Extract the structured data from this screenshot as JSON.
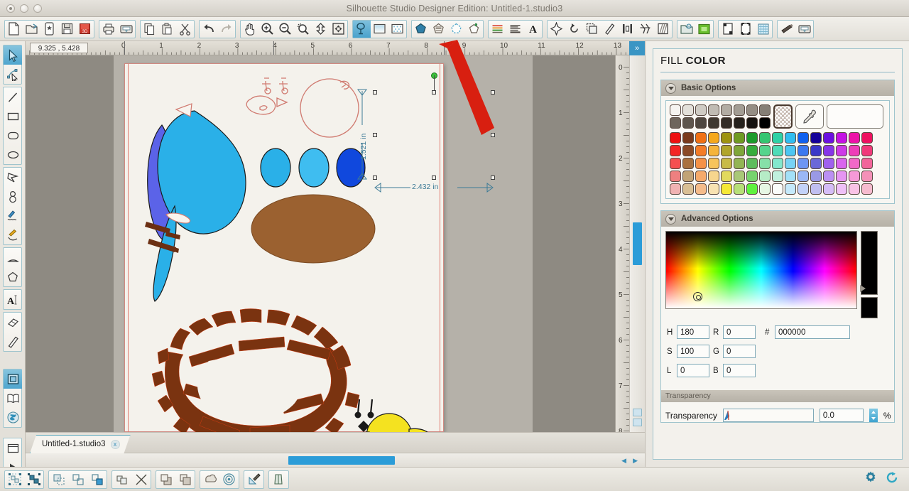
{
  "window": {
    "title": "Silhouette Studio Designer Edition: Untitled-1.studio3",
    "traffic_lights": [
      "close-button",
      "minimize-button",
      "zoom-button"
    ]
  },
  "toolbar": {
    "groups": [
      {
        "name": "file-group",
        "buttons": [
          {
            "name": "new-document",
            "icon": "page-icon"
          },
          {
            "name": "open-document",
            "icon": "open-folder-icon"
          },
          {
            "name": "new-library-item",
            "icon": "card-icon"
          },
          {
            "name": "save-document",
            "icon": "floppy-icon"
          },
          {
            "name": "save-3d",
            "icon": "3d-card-icon"
          }
        ]
      },
      {
        "name": "print-group",
        "buttons": [
          {
            "name": "print",
            "icon": "printer-icon"
          },
          {
            "name": "send-to-silhouette",
            "icon": "cutter-icon"
          }
        ]
      },
      {
        "name": "clipboard-group",
        "buttons": [
          {
            "name": "copy",
            "icon": "copy-icon"
          },
          {
            "name": "paste",
            "icon": "paste-icon"
          },
          {
            "name": "cut",
            "icon": "scissors-icon"
          }
        ]
      },
      {
        "name": "history-group",
        "buttons": [
          {
            "name": "undo",
            "icon": "undo-arrow-icon"
          },
          {
            "name": "redo",
            "icon": "redo-arrow-icon"
          }
        ]
      },
      {
        "name": "view-group",
        "buttons": [
          {
            "name": "pan-tool",
            "icon": "hand-icon"
          },
          {
            "name": "zoom-in",
            "icon": "magnifier-plus-icon"
          },
          {
            "name": "zoom-out",
            "icon": "magnifier-minus-icon"
          },
          {
            "name": "zoom-selection",
            "icon": "magnifier-selection-icon"
          },
          {
            "name": "fit-to-page",
            "icon": "fit-page-icon"
          },
          {
            "name": "fit-to-window",
            "icon": "fit-window-icon"
          }
        ]
      },
      {
        "name": "style-group",
        "buttons": [
          {
            "name": "fill-color-panel",
            "icon": "fill-color-icon",
            "selected": true
          },
          {
            "name": "gradient-fill-panel",
            "icon": "gradient-icon"
          },
          {
            "name": "pattern-fill-panel",
            "icon": "pattern-icon"
          }
        ]
      },
      {
        "name": "line-group",
        "buttons": [
          {
            "name": "line-color-panel",
            "icon": "line-color-pentagon-icon"
          },
          {
            "name": "line-style-panel",
            "icon": "line-style-pentagon-icon"
          },
          {
            "name": "line-thickness-panel",
            "icon": "dashed-pentagon-icon"
          },
          {
            "name": "sketch-panel",
            "icon": "sketch-pentagon-icon"
          }
        ]
      },
      {
        "name": "text-group",
        "buttons": [
          {
            "name": "text-style-panel",
            "icon": "text-lines-colored-icon"
          },
          {
            "name": "paragraph-panel",
            "icon": "text-lines-icon"
          },
          {
            "name": "text-panel",
            "icon": "letter-a-icon"
          }
        ]
      },
      {
        "name": "transform-group",
        "buttons": [
          {
            "name": "transform-panel",
            "icon": "move-arrows-icon"
          },
          {
            "name": "replicate-panel",
            "icon": "rotate-icon"
          },
          {
            "name": "offset-panel",
            "icon": "offset-icon"
          },
          {
            "name": "knife-panel",
            "icon": "knife-icon"
          },
          {
            "name": "align-panel",
            "icon": "align-icon"
          },
          {
            "name": "modify-panel",
            "icon": "modify-icon"
          },
          {
            "name": "trace-panel",
            "icon": "trace-icon"
          }
        ]
      },
      {
        "name": "library-group",
        "buttons": [
          {
            "name": "my-library",
            "icon": "library-icon"
          },
          {
            "name": "store",
            "icon": "store-icon"
          }
        ]
      },
      {
        "name": "page-group",
        "buttons": [
          {
            "name": "page-setup",
            "icon": "page-setup-icon"
          },
          {
            "name": "registration-marks",
            "icon": "registration-marks-icon"
          },
          {
            "name": "grid-settings",
            "icon": "grid-icon"
          }
        ]
      },
      {
        "name": "cut-group",
        "buttons": [
          {
            "name": "cut-settings",
            "icon": "blade-icon"
          },
          {
            "name": "send-to-cutter",
            "icon": "send-cutter-icon"
          }
        ]
      }
    ]
  },
  "left_toolbar": {
    "groups": [
      {
        "name": "select-group",
        "buttons": [
          {
            "name": "select-tool",
            "icon": "arrow-cursor-icon",
            "selected": true
          },
          {
            "name": "edit-points-tool",
            "icon": "edit-points-icon"
          }
        ]
      },
      {
        "name": "shape-group",
        "buttons": [
          {
            "name": "line-tool",
            "icon": "line-icon"
          },
          {
            "name": "rectangle-tool",
            "icon": "rectangle-icon"
          },
          {
            "name": "rounded-rectangle-tool",
            "icon": "rounded-rectangle-icon"
          },
          {
            "name": "ellipse-tool",
            "icon": "ellipse-icon"
          }
        ]
      },
      {
        "name": "draw-group",
        "buttons": [
          {
            "name": "polygon-tool",
            "icon": "polygon-icon"
          },
          {
            "name": "curve-tool",
            "icon": "curve-icon"
          },
          {
            "name": "freehand-tool",
            "icon": "freehand-icon"
          },
          {
            "name": "smooth-freehand-tool",
            "icon": "smooth-freehand-icon"
          }
        ]
      },
      {
        "name": "arc-group",
        "buttons": [
          {
            "name": "arc-tool",
            "icon": "arc-icon"
          },
          {
            "name": "regular-polygon-tool",
            "icon": "pentagon-icon"
          }
        ]
      },
      {
        "name": "text-group",
        "buttons": [
          {
            "name": "text-tool",
            "icon": "text-cursor-icon"
          }
        ]
      },
      {
        "name": "eraser-group",
        "buttons": [
          {
            "name": "eraser-tool",
            "icon": "eraser-icon"
          },
          {
            "name": "knife-tool",
            "icon": "knife-blade-icon"
          }
        ]
      },
      {
        "name": "view-mode-group",
        "buttons": [
          {
            "name": "design-view",
            "icon": "design-page-icon",
            "selected": true
          },
          {
            "name": "library-view",
            "icon": "open-book-icon"
          },
          {
            "name": "store-view",
            "icon": "globe-icon"
          }
        ]
      },
      {
        "name": "preview-group",
        "buttons": [
          {
            "name": "cut-preview",
            "icon": "window-icon"
          },
          {
            "name": "send-preview",
            "icon": "play-triangle-icon"
          }
        ]
      }
    ]
  },
  "canvas": {
    "coordinates": "9.325 , 5.428",
    "h_ruler_ticks": [
      "1",
      "0",
      "1",
      "2",
      "3",
      "4",
      "5",
      "6",
      "7",
      "8",
      "9",
      "10",
      "11",
      "12",
      "13"
    ],
    "v_ruler_ticks": [
      "0",
      "1",
      "2",
      "3",
      "4",
      "5",
      "6",
      "7",
      "8"
    ],
    "selection": {
      "width_label": "2.432 in",
      "height_label": "1.521 in"
    },
    "expand_button": "»",
    "scroll_left_arrow": "◀",
    "scroll_right_arrow": "▶"
  },
  "tabs": [
    {
      "name": "document-tab",
      "label": "Untitled-1.studio3",
      "close": "x",
      "active": true
    }
  ],
  "panel": {
    "title_word1": "FILL",
    "title_word2": "COLOR",
    "basic_options": {
      "label": "Basic Options"
    },
    "advanced_options": {
      "label": "Advanced Options"
    },
    "swatches": {
      "grays_row1": [
        "#f6f4f1",
        "#e3e0da",
        "#cfcbc4",
        "#c0bbb3",
        "#b2aca3",
        "#a39d94",
        "#948d84",
        "#857e75"
      ],
      "grays_row2": [
        "#6e655c",
        "#5e554d",
        "#4e463f",
        "#3f3830",
        "#332c26",
        "#26211c",
        "#171310",
        "#000000"
      ],
      "colors": [
        [
          "#ee1111",
          "#7a3a1c",
          "#f07014",
          "#f5a81c",
          "#9e9310",
          "#6f9a22",
          "#1d9a2a",
          "#35c571",
          "#2ed1a6",
          "#31bdf0",
          "#1060ee",
          "#140098",
          "#6a11e0",
          "#c412e4",
          "#ec13a8",
          "#ee1160"
        ],
        [
          "#f32525",
          "#8a4a27",
          "#f37c28",
          "#f5b43a",
          "#b0a52a",
          "#7fa63a",
          "#37ac3c",
          "#55d48c",
          "#4fdcb8",
          "#4dc6f2",
          "#3b78f0",
          "#3a38c8",
          "#8635e8",
          "#cd3ae8",
          "#ee3db8",
          "#f03a7a"
        ],
        [
          "#f55050",
          "#a9713f",
          "#f59146",
          "#f7c45c",
          "#c8bb46",
          "#93b554",
          "#5dbc5c",
          "#86e0a8",
          "#83e8ce",
          "#78d3f5",
          "#6e95f3",
          "#6a68d8",
          "#a061ee",
          "#d964ee",
          "#f168c8",
          "#f2649a"
        ],
        [
          "#ee8080",
          "#c2a376",
          "#f6aa6b",
          "#f7d68e",
          "#e2d95e",
          "#a9c877",
          "#77d36e",
          "#b6ecc6",
          "#c0f0de",
          "#a3e0f7",
          "#9bb7f6",
          "#9a99e6",
          "#bb90f3",
          "#e595f3",
          "#f599d8",
          "#f491b8"
        ],
        [
          "#f0b3b3",
          "#d9bf95",
          "#f5bc8b",
          "#f8e3b2",
          "#f5e836",
          "#b6df78",
          "#5ef23e",
          "#e6f7e4",
          "#fafcfa",
          "#c5e9fb",
          "#c3d2f9",
          "#c0bef0",
          "#d4bdf7",
          "#eec0f7",
          "#f9c3e6",
          "#f6bbcf"
        ]
      ],
      "none_swatch": "transparent-none",
      "eyedropper": "eyedropper-icon",
      "custom_swatch": "#ffffff"
    },
    "color_fields": [
      {
        "label": "H",
        "value": "180"
      },
      {
        "label": "S",
        "value": "100"
      },
      {
        "label": "L",
        "value": "0"
      }
    ],
    "rgb_fields": [
      {
        "label": "R",
        "value": "0"
      },
      {
        "label": "G",
        "value": "0"
      },
      {
        "label": "B",
        "value": "0"
      }
    ],
    "hex_field": {
      "label": "#",
      "value": "000000"
    },
    "transparency": {
      "section_label": "Transparency",
      "row_label": "Transparency",
      "value": "0.0",
      "unit": "%"
    },
    "accent_color": "#3a95c4"
  },
  "bottom_bar": {
    "groups": [
      {
        "name": "group-ungroup-group",
        "buttons": [
          {
            "name": "group-button",
            "icon": "group-icon"
          },
          {
            "name": "ungroup-button",
            "icon": "ungroup-icon"
          }
        ]
      },
      {
        "name": "compound-group",
        "buttons": [
          {
            "name": "make-compound-path",
            "icon": "compound-path-icon"
          },
          {
            "name": "release-compound-path",
            "icon": "release-compound-icon"
          },
          {
            "name": "merge-button",
            "icon": "merge-icon"
          }
        ]
      },
      {
        "name": "weld-group",
        "buttons": [
          {
            "name": "weld-button",
            "icon": "weld-icon"
          },
          {
            "name": "detach-button",
            "icon": "detach-x-icon"
          }
        ]
      },
      {
        "name": "arrange-group",
        "buttons": [
          {
            "name": "bring-to-front",
            "icon": "bring-front-icon"
          },
          {
            "name": "send-to-back",
            "icon": "send-back-icon"
          }
        ]
      },
      {
        "name": "effects-group",
        "buttons": [
          {
            "name": "shadow-button",
            "icon": "shadow-icon"
          },
          {
            "name": "offset-rings-button",
            "icon": "concentric-rings-icon"
          }
        ]
      },
      {
        "name": "sketch-group",
        "buttons": [
          {
            "name": "sketch-pen-button",
            "icon": "pen-triangle-icon"
          }
        ]
      },
      {
        "name": "layers-group",
        "buttons": [
          {
            "name": "layers-button",
            "icon": "layers-icon"
          }
        ]
      }
    ],
    "right_icons": [
      {
        "name": "preferences-gear-icon"
      },
      {
        "name": "sync-refresh-icon"
      }
    ]
  },
  "annotation": {
    "red_arrow": "red-pointer-arrow",
    "arrow_color": "#d81f10"
  }
}
